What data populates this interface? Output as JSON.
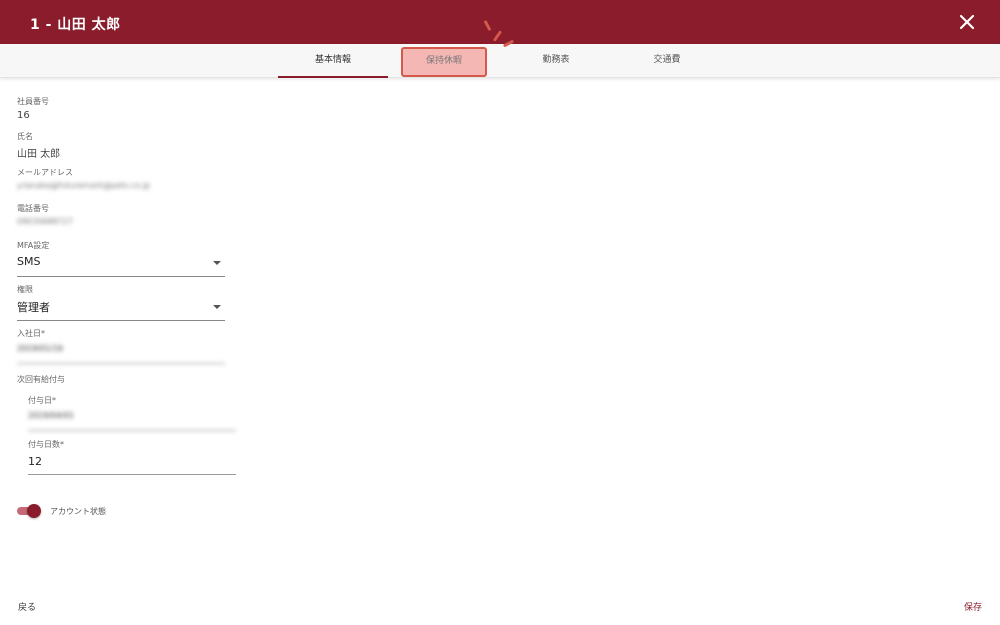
{
  "header": {
    "title": "1 - 山田 太郎",
    "close_icon": "close-icon"
  },
  "tabs": [
    {
      "label": "基本情報",
      "active": true
    },
    {
      "label": "保持休暇",
      "highlighted": true
    },
    {
      "label": "勤務表"
    },
    {
      "label": "交通費"
    }
  ],
  "form": {
    "employee_number": {
      "label": "社員番号",
      "value": "16"
    },
    "name": {
      "label": "氏名",
      "value": "山田 太郎"
    },
    "email": {
      "label": "メールアドレス",
      "value": "y.tanaka@futuremark@pets.co.jp"
    },
    "phone": {
      "label": "電話番号",
      "value": "09030688727"
    },
    "mfa": {
      "label": "MFA設定",
      "value": "SMS"
    },
    "role": {
      "label": "権限",
      "value": "管理者"
    },
    "join_date": {
      "label": "入社日*",
      "value": "2019/01/16"
    },
    "next_paid_leave": {
      "label": "次回有給付与",
      "grant_date": {
        "label": "付与日*",
        "value": "2019/04/01"
      },
      "grant_days": {
        "label": "付与日数*",
        "value": "12"
      }
    },
    "account_status": {
      "label": "アカウント状態",
      "enabled": true
    }
  },
  "footer": {
    "back_label": "戻る",
    "save_label": "保存"
  },
  "colors": {
    "brand": "#8a1c2b",
    "highlight_fill": "#f4b7b4",
    "highlight_border": "#d4584b"
  }
}
